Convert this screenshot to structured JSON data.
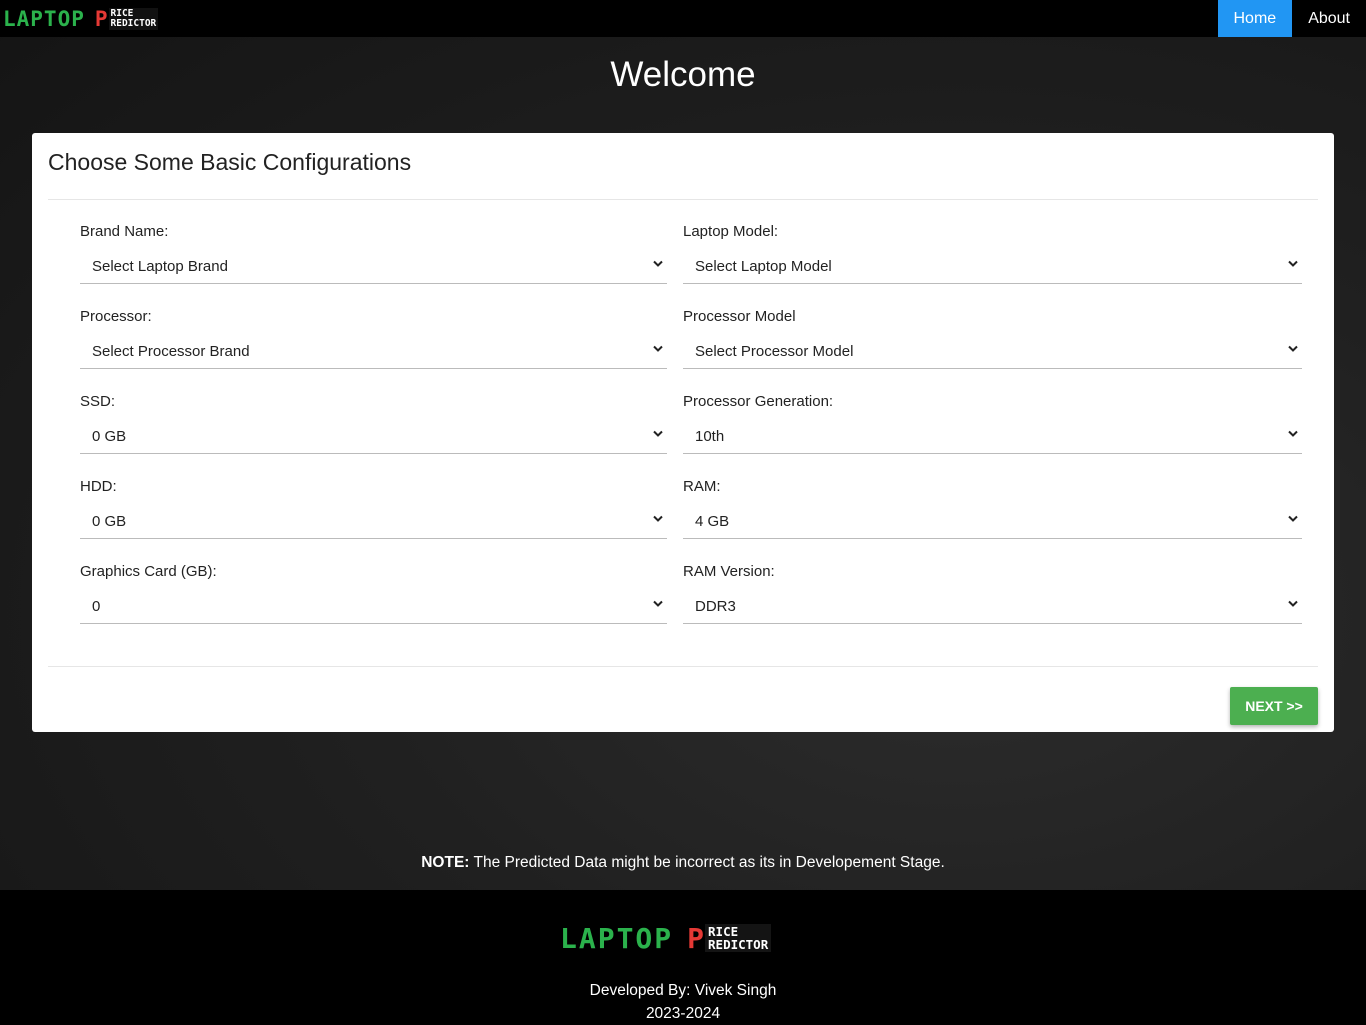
{
  "brand": {
    "main": "LAPTOP",
    "p": "P",
    "sub_line1": "RICE",
    "sub_line2": "REDICTOR"
  },
  "nav": {
    "home": "Home",
    "about": "About"
  },
  "welcome": "Welcome",
  "card": {
    "title": "Choose Some Basic Configurations",
    "fields": {
      "brand": {
        "label": "Brand Name:",
        "value": "Select Laptop Brand"
      },
      "model": {
        "label": "Laptop Model:",
        "value": "Select Laptop Model"
      },
      "processor": {
        "label": "Processor:",
        "value": "Select Processor Brand"
      },
      "processor_model": {
        "label": "Processor Model",
        "value": "Select Processor Model"
      },
      "ssd": {
        "label": "SSD:",
        "value": "0 GB"
      },
      "processor_gen": {
        "label": "Processor Generation:",
        "value": "10th"
      },
      "hdd": {
        "label": "HDD:",
        "value": "0 GB"
      },
      "ram": {
        "label": "RAM:",
        "value": "4 GB"
      },
      "graphics": {
        "label": "Graphics Card (GB):",
        "value": "0"
      },
      "ram_version": {
        "label": "RAM Version:",
        "value": "DDR3"
      }
    },
    "next_label": "NEXT >>"
  },
  "note": {
    "prefix": "NOTE:",
    "text": " The Predicted Data might be incorrect as its in Developement Stage."
  },
  "footer": {
    "developed_by": "Developed By: Vivek Singh",
    "year": "2023-2024"
  },
  "colors": {
    "accent_nav": "#2196f3",
    "next_button": "#4caf50",
    "logo_green": "#2bb24c",
    "logo_red": "#e53935"
  }
}
